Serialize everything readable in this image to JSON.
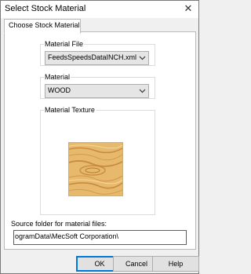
{
  "window": {
    "title": "Select Stock Material"
  },
  "tabs": [
    {
      "label": "Choose Stock Material"
    }
  ],
  "material_file": {
    "group_label": "Material File",
    "selected": "FeedsSpeedsDataINCH.xml"
  },
  "material": {
    "group_label": "Material",
    "selected": "WOOD"
  },
  "texture": {
    "group_label": "Material Texture",
    "colors": {
      "base": "#e7b96d",
      "grain": "#c98b3e",
      "light": "#f6d79b"
    }
  },
  "source_folder": {
    "label": "Source folder for material files:",
    "value": "ogramData\\MecSoft Corporation\\"
  },
  "buttons": {
    "ok": "OK",
    "cancel": "Cancel",
    "help": "Help"
  },
  "icons": {
    "close": "close-icon",
    "dropdown": "chevron-down-icon"
  }
}
